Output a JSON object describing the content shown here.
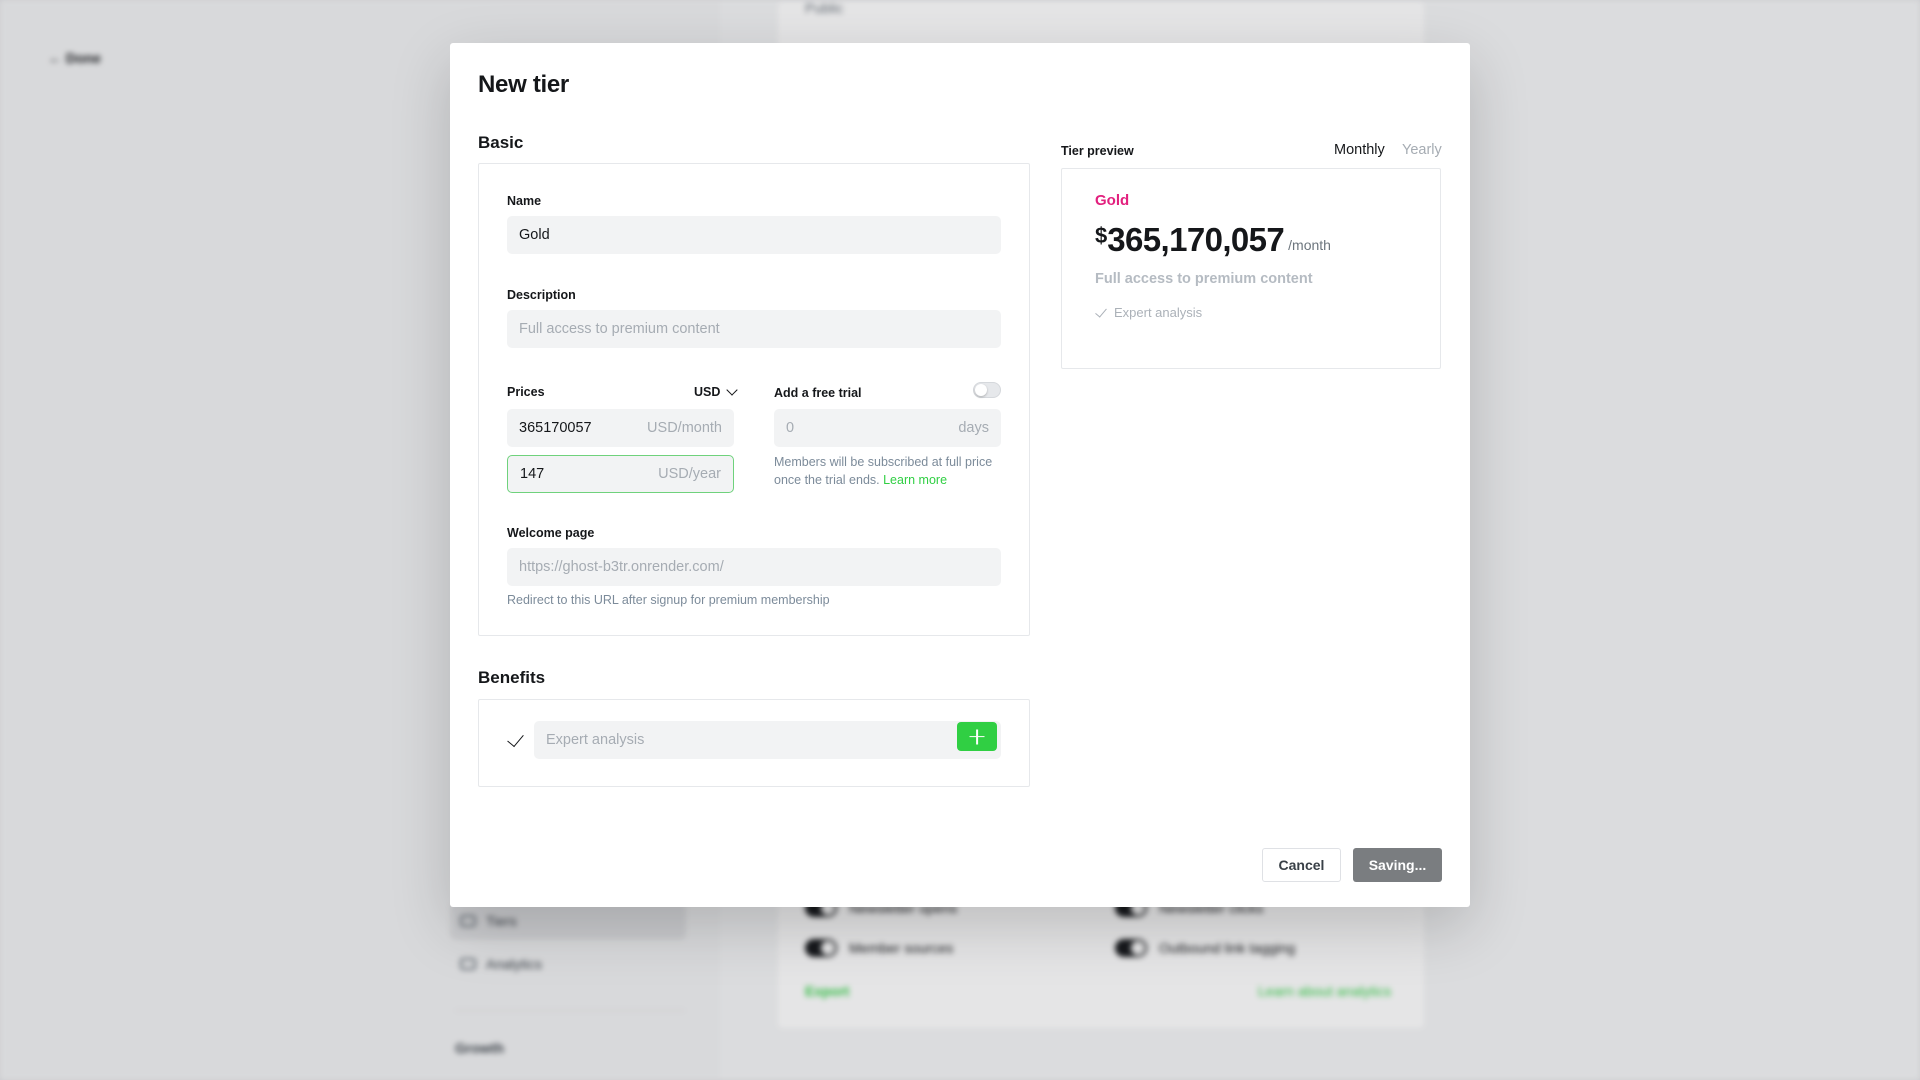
{
  "background": {
    "done_label": "← Done",
    "nav": {
      "tiers": "Tiers",
      "analytics": "Analytics",
      "growth": "Growth"
    },
    "public_label": "Public",
    "toggles": [
      "Newsletter opens",
      "Newsletter clicks",
      "Member sources",
      "Outbound link tagging"
    ],
    "export_label": "Export",
    "learn_label": "Learn about analytics"
  },
  "modal": {
    "title": "New tier",
    "basic": {
      "section_title": "Basic",
      "name_label": "Name",
      "name_value": "Gold",
      "description_label": "Description",
      "description_placeholder": "Full access to premium content",
      "prices_label": "Prices",
      "currency": "USD",
      "monthly_value": "365170057",
      "monthly_unit": "USD/month",
      "yearly_value": "147",
      "yearly_unit": "USD/year",
      "trial_label": "Add a free trial",
      "trial_placeholder": "0",
      "trial_unit": "days",
      "trial_hint": "Members will be subscribed at full price once the trial ends.",
      "trial_hint_link": "Learn more",
      "welcome_label": "Welcome page",
      "welcome_placeholder": "https://ghost-b3tr.onrender.com/",
      "welcome_hint": "Redirect to this URL after signup for premium membership"
    },
    "benefits": {
      "section_title": "Benefits",
      "input_placeholder": "Expert analysis"
    },
    "preview": {
      "label": "Tier preview",
      "tab_monthly": "Monthly",
      "tab_yearly": "Yearly",
      "tier_name": "Gold",
      "currency_symbol": "$",
      "amount": "365,170,057",
      "period": "/month",
      "description": "Full access to premium content",
      "benefit": "Expert analysis"
    },
    "footer": {
      "cancel_label": "Cancel",
      "save_label": "Saving..."
    }
  },
  "colors": {
    "accent": "#30cf43",
    "tier_name": "#e2207e",
    "save_button": "#7a7d80"
  }
}
